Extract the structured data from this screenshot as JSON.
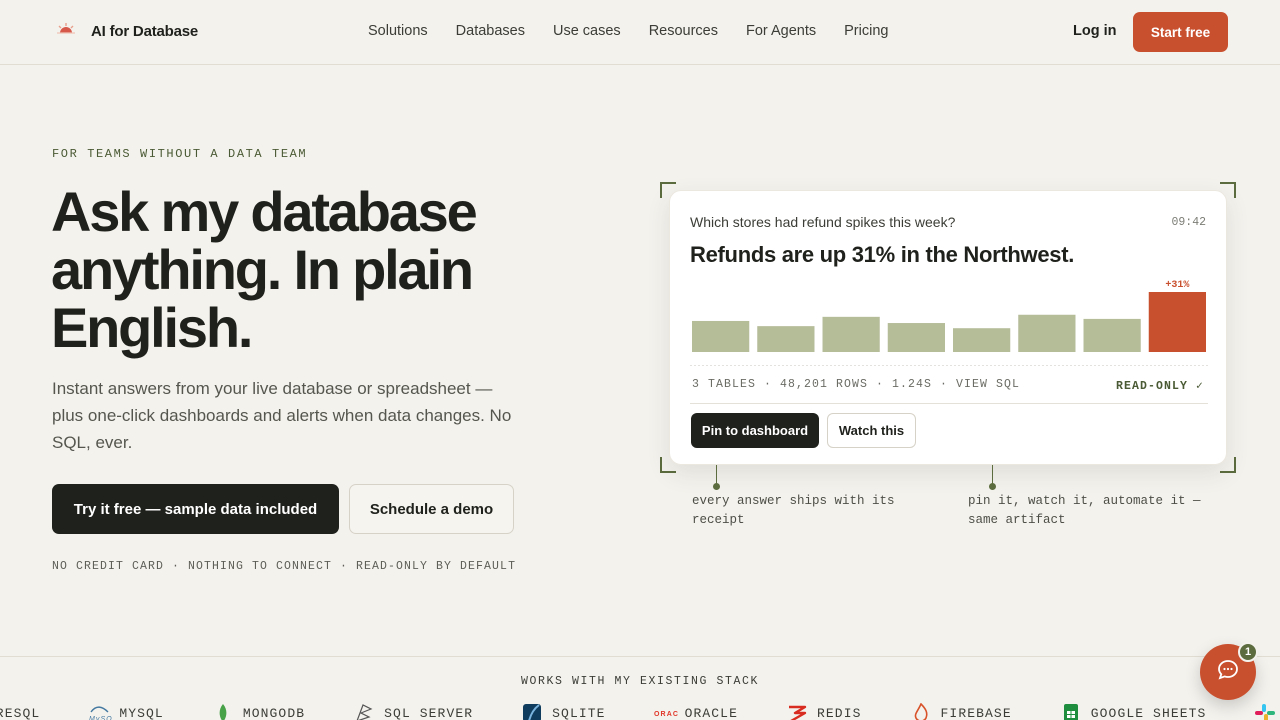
{
  "brand": {
    "name": "AI for Database",
    "icon": "sun-icon"
  },
  "nav": {
    "items": [
      "Solutions",
      "Databases",
      "Use cases",
      "Resources",
      "For Agents",
      "Pricing"
    ],
    "login": "Log in",
    "cta": "Start free"
  },
  "hero": {
    "eyebrow": "FOR TEAMS WITHOUT A DATA TEAM",
    "headline_lines": [
      "Ask my database",
      "anything. In plain",
      "English."
    ],
    "subtitle": "Instant answers from your live database or spreadsheet — plus one-click dashboards and alerts when data changes. No SQL, ever.",
    "primary_cta": "Try it free — sample data included",
    "secondary_cta": "Schedule a demo",
    "fineprint": "NO CREDIT CARD · NOTHING TO CONNECT · READ-ONLY BY DEFAULT"
  },
  "card": {
    "question": "Which stores had refund spikes this week?",
    "time": "09:42",
    "answer": "Refunds are up 31% in the Northwest.",
    "metrics": "3 TABLES · 48,201 ROWS · 1.24S · VIEW SQL",
    "readonly": "READ-ONLY ✓",
    "pin_button": "Pin to dashboard",
    "watch_button": "Watch this"
  },
  "chart_data": {
    "type": "bar",
    "values": [
      30,
      25,
      34,
      28,
      23,
      36,
      32,
      58
    ],
    "highlight_index": 7,
    "highlight_label": "+31%",
    "colors": {
      "bar": "#b5bc98",
      "highlight": "#c9502f"
    }
  },
  "annotations": {
    "left": "every answer ships with its receipt",
    "right": "pin it, watch it, automate it — same artifact"
  },
  "stack": {
    "title": "WORKS WITH MY EXISTING STACK",
    "items": [
      {
        "name": "TGRESQL",
        "icon": ""
      },
      {
        "name": "MYSQL",
        "icon": "mysql-icon"
      },
      {
        "name": "MONGODB",
        "icon": "mongodb-icon"
      },
      {
        "name": "SQL SERVER",
        "icon": "sql-server-icon"
      },
      {
        "name": "SQLITE",
        "icon": "sqlite-icon"
      },
      {
        "name": "ORACLE",
        "icon": "oracle-icon"
      },
      {
        "name": "REDIS",
        "icon": "redis-icon"
      },
      {
        "name": "FIREBASE",
        "icon": "firebase-icon"
      },
      {
        "name": "GOOGLE SHEETS",
        "icon": "google-sheets-icon"
      },
      {
        "name": "",
        "icon": "slack-icon"
      }
    ]
  },
  "chat": {
    "badge": "1",
    "icon": "chat-icon"
  },
  "colors": {
    "accent": "#c9502f",
    "olive": "#5c6c3e",
    "ink": "#1f211c",
    "background": "#f4f2ed"
  }
}
